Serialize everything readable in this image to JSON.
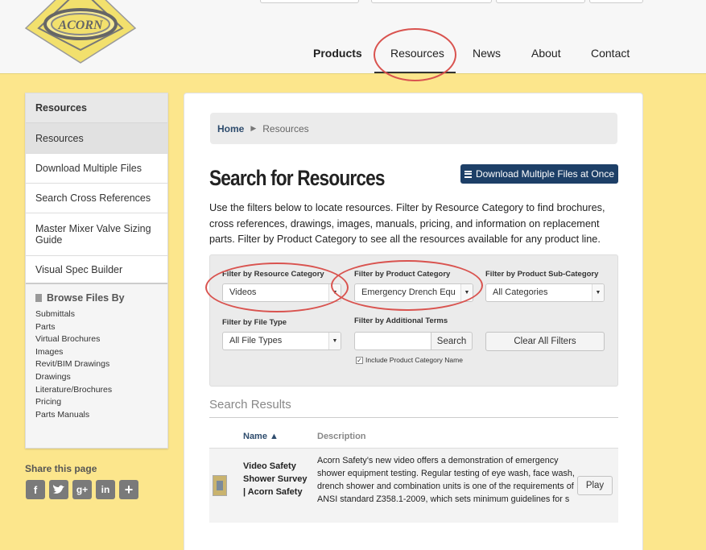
{
  "header": {
    "nav": [
      {
        "label": "Products"
      },
      {
        "label": "Resources"
      },
      {
        "label": "News"
      },
      {
        "label": "About"
      },
      {
        "label": "Contact"
      }
    ]
  },
  "sidebar": {
    "heading": "Resources",
    "items": [
      {
        "label": "Resources"
      },
      {
        "label": "Download Multiple Files"
      },
      {
        "label": "Search Cross References"
      },
      {
        "label": "Master Mixer Valve Sizing Guide"
      },
      {
        "label": "Visual Spec Builder"
      }
    ],
    "browse_title": "Browse Files By",
    "browse_links": [
      "Submittals",
      "Parts",
      "Virtual Brochures",
      "Images",
      "Revit/BIM Drawings",
      "Drawings",
      "Literature/Brochures",
      "Pricing",
      "Parts Manuals"
    ],
    "share_title": "Share this page"
  },
  "main": {
    "breadcrumb": {
      "home": "Home",
      "current": "Resources"
    },
    "title": "Search for Resources",
    "download_button": "Download Multiple Files at Once",
    "intro": "Use the filters below to locate resources. Filter by Resource Category to find brochures, cross references, drawings, images, manuals, pricing, and information on replacement parts. Filter by Product Category to see all the resources available for any product line.",
    "filters": {
      "resource_category_label": "Filter by Resource Category",
      "resource_category_value": "Videos",
      "product_category_label": "Filter by Product Category",
      "product_category_value": "Emergency Drench Equ",
      "sub_category_label": "Filter by Product Sub-Category",
      "sub_category_value": "All Categories",
      "file_type_label": "Filter by File Type",
      "file_type_value": "All File Types",
      "terms_label": "Filter by Additional Terms",
      "terms_value": "",
      "search_button": "Search",
      "clear_button": "Clear All Filters",
      "include_label": "Include Product Category Name",
      "include_checked": true
    },
    "results": {
      "title": "Search Results",
      "col_name": "Name ▲",
      "col_desc": "Description",
      "rows": [
        {
          "name": "Video Safety Shower Survey | Acorn Safety",
          "description": "Acorn Safety's new video offers a demonstration of emergency shower equipment testing. Regular testing of eye wash, face wash, drench shower and combination units is one of the requirements of ANSI standard Z358.1-2009, which sets minimum guidelines for s",
          "action": "Play"
        }
      ]
    }
  },
  "colors": {
    "accent": "#1d3f67",
    "background": "#fce68c",
    "annotation": "#d9534f"
  }
}
